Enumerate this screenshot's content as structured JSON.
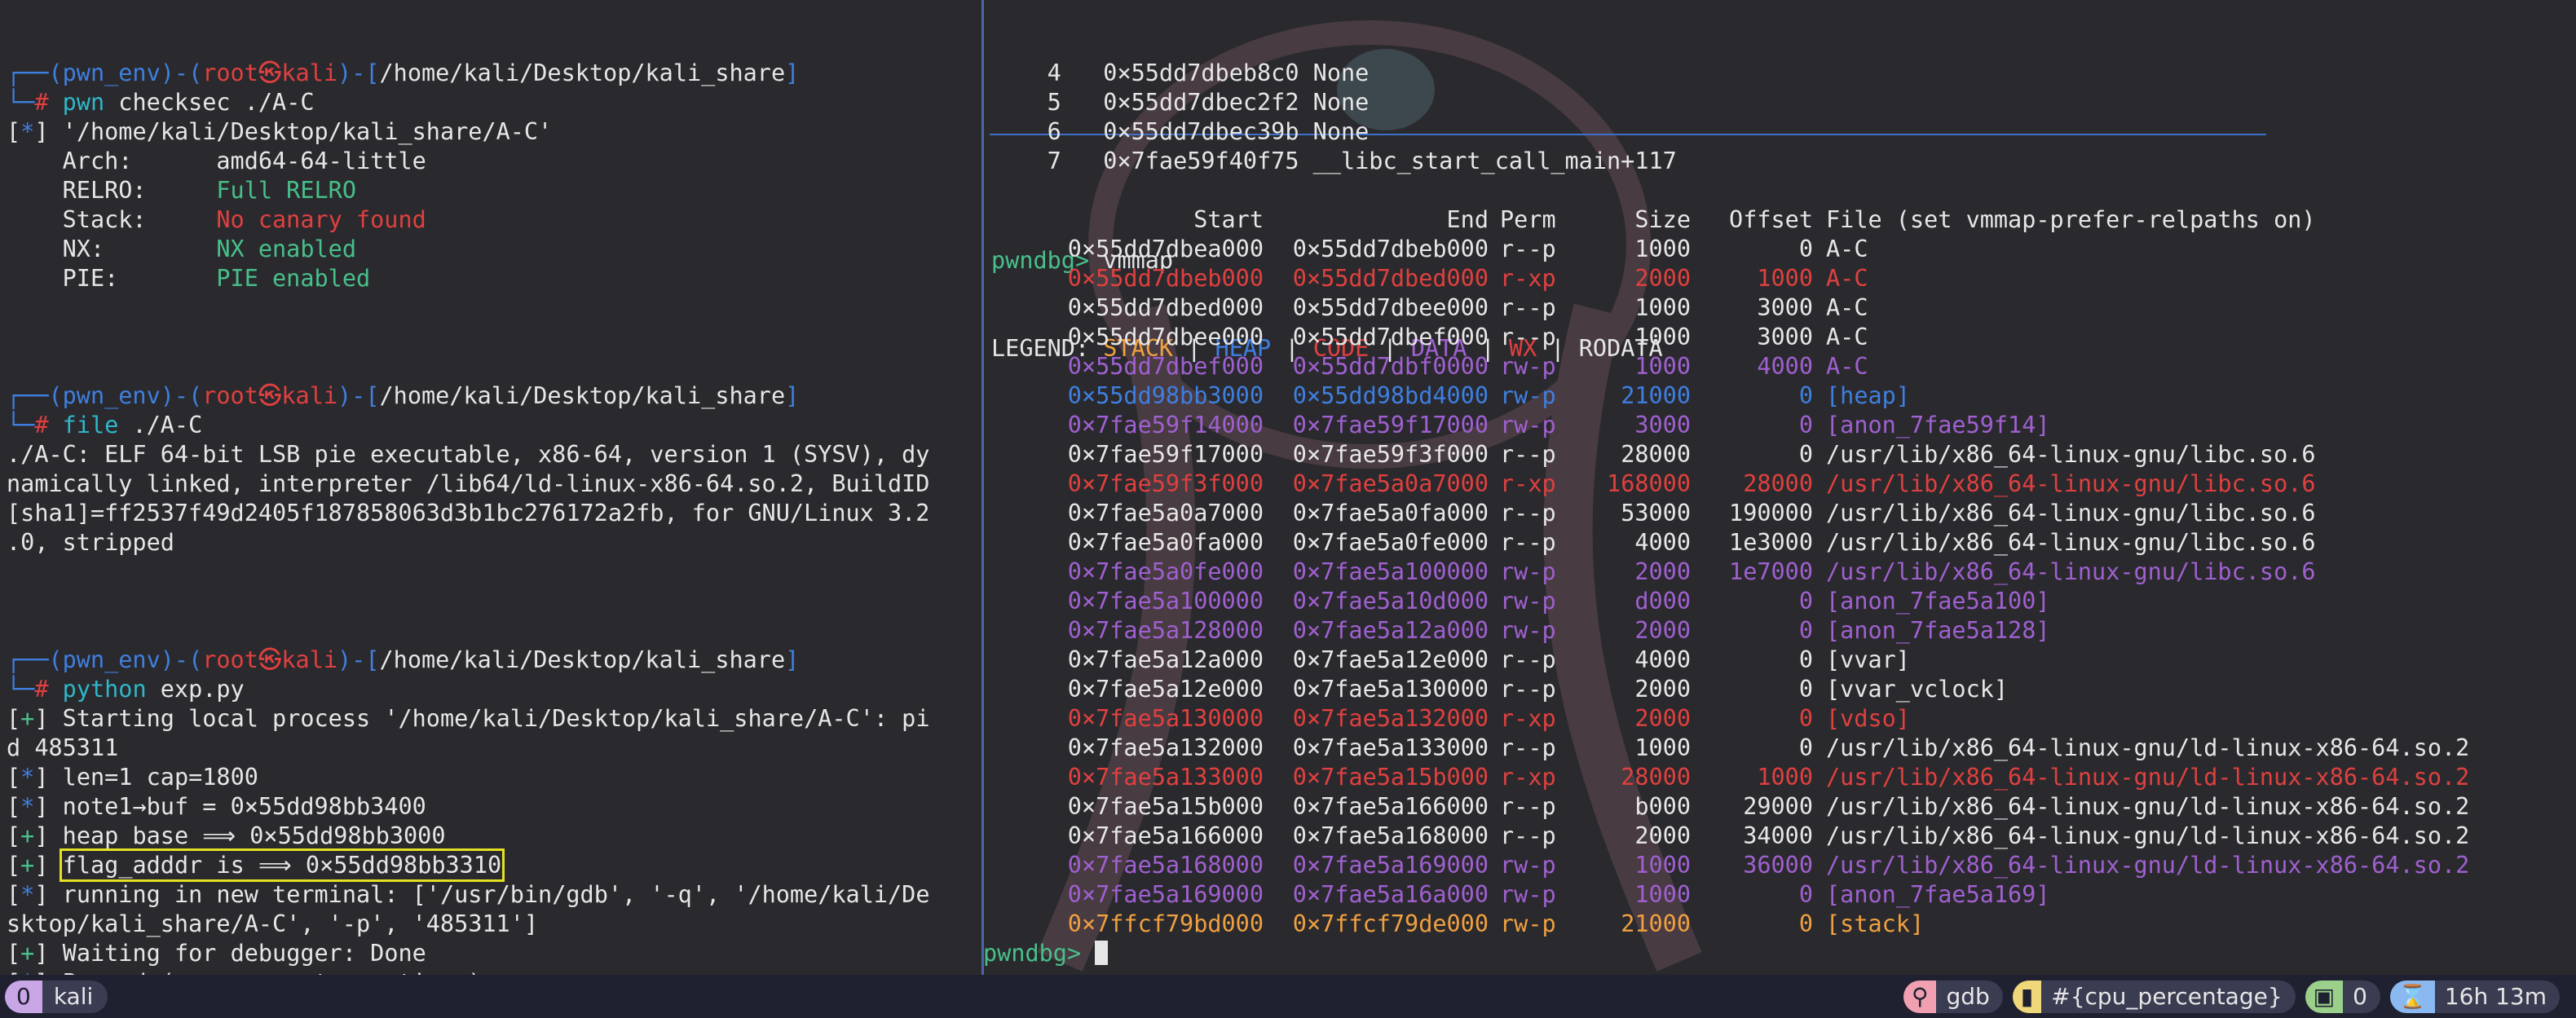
{
  "left": {
    "user_prompt": {
      "env": "pwn_env",
      "user": "root",
      "at_glyph": "㉿",
      "host": "kali",
      "path": "/home/kali/Desktop/kali_share"
    },
    "checksec": {
      "command": "pwn checksec ./A-C",
      "file_line": "'/home/kali/Desktop/kali_share/A-C'",
      "rows": [
        {
          "key": "Arch:",
          "val": "amd64-64-little",
          "color": "#e6e6e6"
        },
        {
          "key": "RELRO:",
          "val": "Full RELRO",
          "color": "#48c08a"
        },
        {
          "key": "Stack:",
          "val": "No canary found",
          "color": "#e0403f"
        },
        {
          "key": "NX:",
          "val": "NX enabled",
          "color": "#48c08a"
        },
        {
          "key": "PIE:",
          "val": "PIE enabled",
          "color": "#48c08a"
        }
      ]
    },
    "file_cmd": {
      "command": "file ./A-C",
      "output": [
        "./A-C: ELF 64-bit LSB pie executable, x86-64, version 1 (SYSV), dy",
        "namically linked, interpreter /lib64/ld-linux-x86-64.so.2, BuildID",
        "[sha1]=ff2537f49d2405f187858063d3b1bc276172a2fb, for GNU/Linux 3.2",
        ".0, stripped"
      ]
    },
    "python_cmd": {
      "command": "python exp.py",
      "output": [
        {
          "tag": "+",
          "text": " Starting local process '/home/kali/Desktop/kali_share/A-C': pi"
        },
        {
          "tag": "",
          "text": "d 485311"
        },
        {
          "tag": "*",
          "text": " len=1 cap=1800"
        },
        {
          "tag": "*",
          "text": " note1→buf = 0×55dd98bb3400"
        },
        {
          "tag": "+",
          "text": " heap base ⟹ 0×55dd98bb3000"
        },
        {
          "tag": "+",
          "text": "flag_adddr is ⟹ 0×55dd98bb3310",
          "highlight": true
        },
        {
          "tag": "*",
          "text": " running in new terminal: ['/usr/bin/gdb', '-q', '/home/kali/De"
        },
        {
          "tag": "",
          "text": "sktop/kali_share/A-C', '-p', '485311']"
        },
        {
          "tag": "+",
          "text": " Waiting for debugger: Done"
        },
        {
          "tag": "*",
          "text": " Paused (press any to continue)"
        }
      ]
    }
  },
  "right": {
    "backtrace": [
      {
        "num": "4",
        "addr": "0×55dd7dbeb8c0",
        "sym": "None"
      },
      {
        "num": "5",
        "addr": "0×55dd7dbec2f2",
        "sym": "None"
      },
      {
        "num": "6",
        "addr": "0×55dd7dbec39b",
        "sym": "None"
      },
      {
        "num": "7",
        "addr": "0×7fae59f40f75",
        "sym": "__libc_start_call_main+117"
      }
    ],
    "prompt": "pwndbg>",
    "command": "vmmap",
    "legend_label": "LEGEND:",
    "legend": [
      {
        "name": "STACK",
        "color": "#f0a040"
      },
      {
        "name": "HEAP",
        "color": "#3f7fe0"
      },
      {
        "name": "CODE",
        "color": "#e0403f"
      },
      {
        "name": "DATA",
        "color": "#a060d0"
      },
      {
        "name": "WX",
        "color": "#e0403f"
      },
      {
        "name": "RODATA",
        "color": "#e6e6e6"
      }
    ],
    "legend_sep": " | ",
    "headers": {
      "start": "Start",
      "end": "End",
      "perm": "Perm",
      "size": "Size",
      "offset": "Offset",
      "file": "File (set vmmap-prefer-relpaths on)"
    },
    "rows": [
      {
        "start": "0×55dd7dbea000",
        "end": "0×55dd7dbeb000",
        "perm": "r--p",
        "size": "1000",
        "offset": "0",
        "file": "A-C",
        "color": "#e6e6e6"
      },
      {
        "start": "0×55dd7dbeb000",
        "end": "0×55dd7dbed000",
        "perm": "r-xp",
        "size": "2000",
        "offset": "1000",
        "file": "A-C",
        "color": "#e0403f"
      },
      {
        "start": "0×55dd7dbed000",
        "end": "0×55dd7dbee000",
        "perm": "r--p",
        "size": "1000",
        "offset": "3000",
        "file": "A-C",
        "color": "#e6e6e6"
      },
      {
        "start": "0×55dd7dbee000",
        "end": "0×55dd7dbef000",
        "perm": "r--p",
        "size": "1000",
        "offset": "3000",
        "file": "A-C",
        "color": "#e6e6e6"
      },
      {
        "start": "0×55dd7dbef000",
        "end": "0×55dd7dbf0000",
        "perm": "rw-p",
        "size": "1000",
        "offset": "4000",
        "file": "A-C",
        "color": "#a060d0"
      },
      {
        "start": "0×55dd98bb3000",
        "end": "0×55dd98bd4000",
        "perm": "rw-p",
        "size": "21000",
        "offset": "0",
        "file": "[heap]",
        "color": "#3f7fe0"
      },
      {
        "start": "0×7fae59f14000",
        "end": "0×7fae59f17000",
        "perm": "rw-p",
        "size": "3000",
        "offset": "0",
        "file": "[anon_7fae59f14]",
        "color": "#a060d0"
      },
      {
        "start": "0×7fae59f17000",
        "end": "0×7fae59f3f000",
        "perm": "r--p",
        "size": "28000",
        "offset": "0",
        "file": "/usr/lib/x86_64-linux-gnu/libc.so.6",
        "color": "#e6e6e6"
      },
      {
        "start": "0×7fae59f3f000",
        "end": "0×7fae5a0a7000",
        "perm": "r-xp",
        "size": "168000",
        "offset": "28000",
        "file": "/usr/lib/x86_64-linux-gnu/libc.so.6",
        "color": "#e0403f"
      },
      {
        "start": "0×7fae5a0a7000",
        "end": "0×7fae5a0fa000",
        "perm": "r--p",
        "size": "53000",
        "offset": "190000",
        "file": "/usr/lib/x86_64-linux-gnu/libc.so.6",
        "color": "#e6e6e6"
      },
      {
        "start": "0×7fae5a0fa000",
        "end": "0×7fae5a0fe000",
        "perm": "r--p",
        "size": "4000",
        "offset": "1e3000",
        "file": "/usr/lib/x86_64-linux-gnu/libc.so.6",
        "color": "#e6e6e6"
      },
      {
        "start": "0×7fae5a0fe000",
        "end": "0×7fae5a100000",
        "perm": "rw-p",
        "size": "2000",
        "offset": "1e7000",
        "file": "/usr/lib/x86_64-linux-gnu/libc.so.6",
        "color": "#a060d0"
      },
      {
        "start": "0×7fae5a100000",
        "end": "0×7fae5a10d000",
        "perm": "rw-p",
        "size": "d000",
        "offset": "0",
        "file": "[anon_7fae5a100]",
        "color": "#a060d0"
      },
      {
        "start": "0×7fae5a128000",
        "end": "0×7fae5a12a000",
        "perm": "rw-p",
        "size": "2000",
        "offset": "0",
        "file": "[anon_7fae5a128]",
        "color": "#a060d0"
      },
      {
        "start": "0×7fae5a12a000",
        "end": "0×7fae5a12e000",
        "perm": "r--p",
        "size": "4000",
        "offset": "0",
        "file": "[vvar]",
        "color": "#e6e6e6"
      },
      {
        "start": "0×7fae5a12e000",
        "end": "0×7fae5a130000",
        "perm": "r--p",
        "size": "2000",
        "offset": "0",
        "file": "[vvar_vclock]",
        "color": "#e6e6e6"
      },
      {
        "start": "0×7fae5a130000",
        "end": "0×7fae5a132000",
        "perm": "r-xp",
        "size": "2000",
        "offset": "0",
        "file": "[vdso]",
        "color": "#e0403f"
      },
      {
        "start": "0×7fae5a132000",
        "end": "0×7fae5a133000",
        "perm": "r--p",
        "size": "1000",
        "offset": "0",
        "file": "/usr/lib/x86_64-linux-gnu/ld-linux-x86-64.so.2",
        "color": "#e6e6e6"
      },
      {
        "start": "0×7fae5a133000",
        "end": "0×7fae5a15b000",
        "perm": "r-xp",
        "size": "28000",
        "offset": "1000",
        "file": "/usr/lib/x86_64-linux-gnu/ld-linux-x86-64.so.2",
        "color": "#e0403f"
      },
      {
        "start": "0×7fae5a15b000",
        "end": "0×7fae5a166000",
        "perm": "r--p",
        "size": "b000",
        "offset": "29000",
        "file": "/usr/lib/x86_64-linux-gnu/ld-linux-x86-64.so.2",
        "color": "#e6e6e6"
      },
      {
        "start": "0×7fae5a166000",
        "end": "0×7fae5a168000",
        "perm": "r--p",
        "size": "2000",
        "offset": "34000",
        "file": "/usr/lib/x86_64-linux-gnu/ld-linux-x86-64.so.2",
        "color": "#e6e6e6"
      },
      {
        "start": "0×7fae5a168000",
        "end": "0×7fae5a169000",
        "perm": "rw-p",
        "size": "1000",
        "offset": "36000",
        "file": "/usr/lib/x86_64-linux-gnu/ld-linux-x86-64.so.2",
        "color": "#a060d0"
      },
      {
        "start": "0×7fae5a169000",
        "end": "0×7fae5a16a000",
        "perm": "rw-p",
        "size": "1000",
        "offset": "0",
        "file": "[anon_7fae5a169]",
        "color": "#a060d0"
      },
      {
        "start": "0×7ffcf79bd000",
        "end": "0×7ffcf79de000",
        "perm": "rw-p",
        "size": "21000",
        "offset": "0",
        "file": "[stack]",
        "color": "#f0a040"
      }
    ],
    "final_prompt": "pwndbg>"
  },
  "status": {
    "session_num": "0",
    "session_name": "kali",
    "right": [
      {
        "icon": "⚲",
        "text": "gdb",
        "icon_color": "#f0a0b0"
      },
      {
        "icon": "▮",
        "text": "#{cpu_percentage}",
        "icon_color": "#f0d87a"
      },
      {
        "icon": "▣",
        "text": "0",
        "icon_color": "#9ad08a"
      },
      {
        "icon": "⌛",
        "text": "16h 13m",
        "icon_color": "#8ab8f0"
      }
    ]
  }
}
